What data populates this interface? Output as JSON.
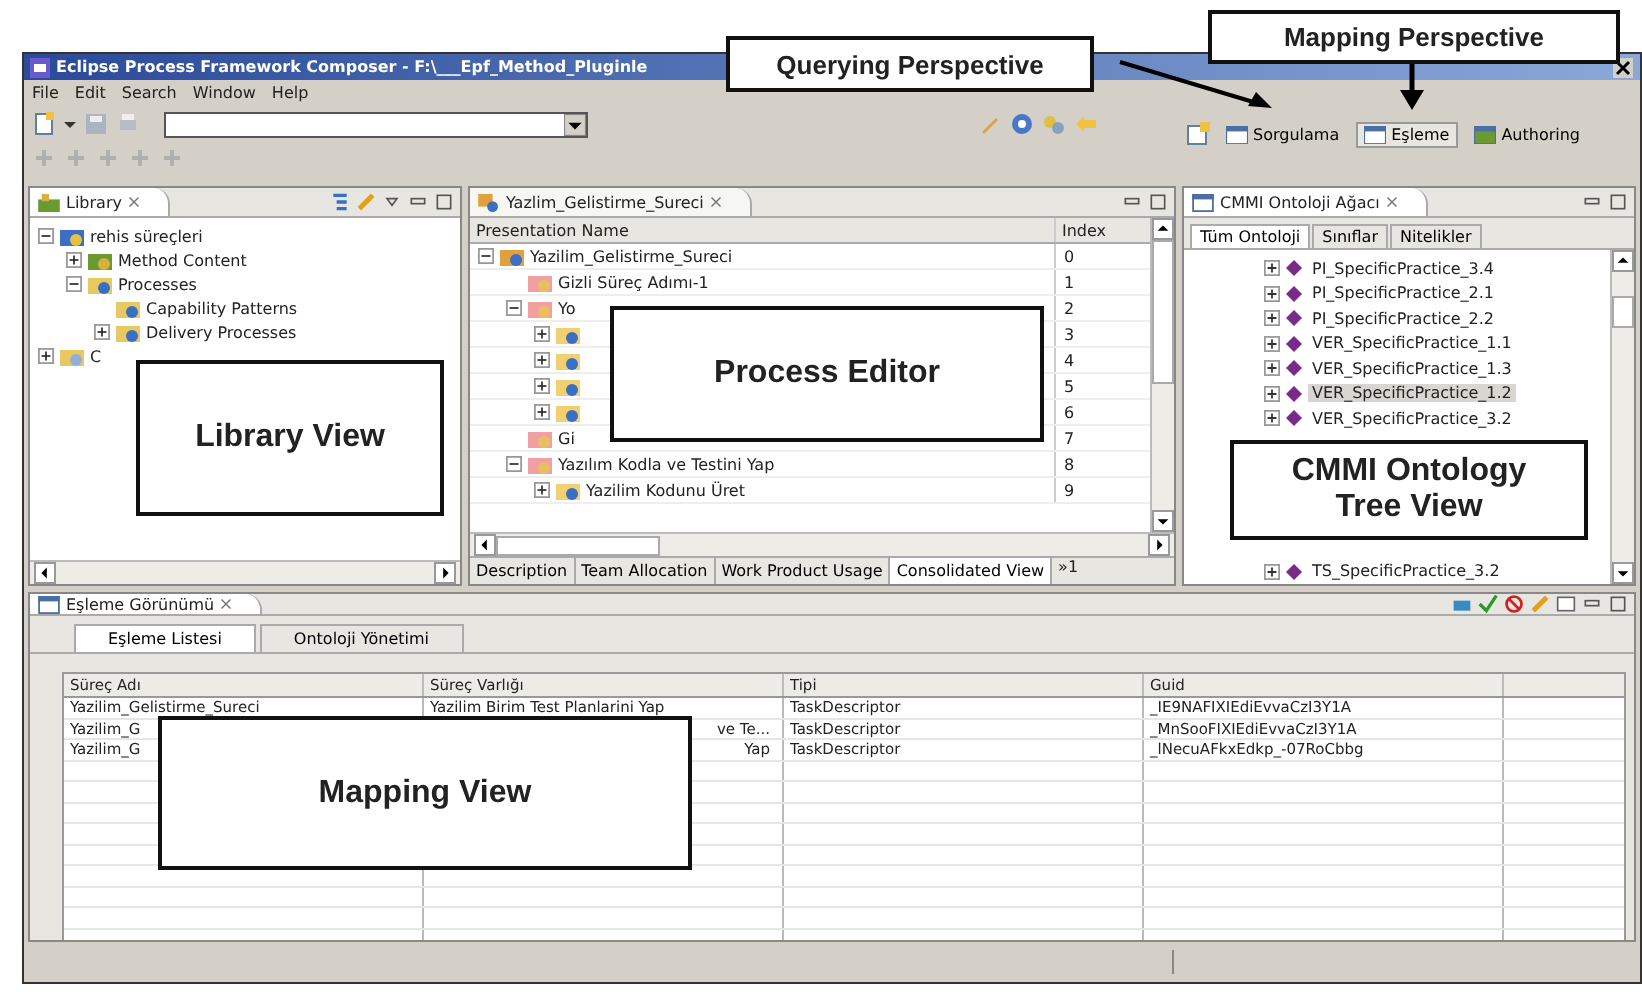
{
  "window": {
    "title": "Eclipse Process Framework Composer - F:\\___Epf_Method_Pluginle"
  },
  "menu": [
    "File",
    "Edit",
    "Search",
    "Window",
    "Help"
  ],
  "perspectives": [
    {
      "label": "Sorgulama",
      "selected": false
    },
    {
      "label": "Eşleme",
      "selected": true
    },
    {
      "label": "Authoring",
      "selected": false
    }
  ],
  "callouts": {
    "querying": "Querying Perspective",
    "mapping": "Mapping Perspective"
  },
  "library": {
    "title": "Library",
    "callout": "Library View",
    "tree": [
      {
        "label": "rehis süreçleri",
        "kind": "plugin",
        "expanded": true,
        "children": [
          {
            "label": "Method Content",
            "kind": "content",
            "expanded": false
          },
          {
            "label": "Processes",
            "kind": "processes",
            "expanded": true,
            "children": [
              {
                "label": "Capability Patterns",
                "kind": "pattern"
              },
              {
                "label": "Delivery Processes",
                "kind": "pattern",
                "expanded": false
              }
            ]
          }
        ]
      },
      {
        "label": "C",
        "kind": "folder",
        "expanded": false
      }
    ]
  },
  "editor": {
    "title": "Yazlim_Gelistirme_Sureci",
    "callout": "Process Editor",
    "columns": [
      "Presentation Name",
      "Index"
    ],
    "rows": [
      {
        "label": "Yazilim_Gelistirme_Sureci",
        "index": "0",
        "kind": "process",
        "expanded": true,
        "children": [
          {
            "label": "Gizli Süreç Adımı-1",
            "index": "1",
            "kind": "phase"
          },
          {
            "label": "Yo",
            "index": "2",
            "kind": "phase",
            "expanded": true,
            "children": [
              {
                "index": "3",
                "kind": "activity",
                "expanded": false
              },
              {
                "index": "4",
                "kind": "activity",
                "expanded": false
              },
              {
                "index": "5",
                "kind": "activity",
                "expanded": false
              },
              {
                "index": "6",
                "kind": "activity",
                "expanded": false
              }
            ]
          },
          {
            "label": "Gi",
            "index": "7",
            "kind": "phase"
          },
          {
            "label": "Yazılım Kodla ve Testini Yap",
            "index": "8",
            "kind": "phase",
            "expanded": true,
            "children": [
              {
                "label": "Yazilim Kodunu Üret",
                "index": "9",
                "kind": "activity",
                "expanded": false
              }
            ]
          }
        ]
      }
    ],
    "tabs": [
      {
        "label": "Description",
        "selected": false
      },
      {
        "label": "Team Allocation",
        "selected": false
      },
      {
        "label": "Work Product Usage",
        "selected": false
      },
      {
        "label": "Consolidated View",
        "selected": true
      }
    ],
    "overflow": "»1"
  },
  "ontology": {
    "title": "CMMI Ontoloji Ağacı",
    "callout": "CMMI Ontology\nTree View",
    "tabs": [
      {
        "label": "Tüm Ontoloji",
        "selected": true
      },
      {
        "label": "Sınıflar",
        "selected": false
      },
      {
        "label": "Nitelikler",
        "selected": false
      }
    ],
    "items": [
      {
        "label": "PI_SpecificPractice_3.4",
        "selected": false
      },
      {
        "label": "PI_SpecificPractice_2.1",
        "selected": false
      },
      {
        "label": "PI_SpecificPractice_2.2",
        "selected": false
      },
      {
        "label": "VER_SpecificPractice_1.1",
        "selected": false
      },
      {
        "label": "VER_SpecificPractice_1.3",
        "selected": false
      },
      {
        "label": "VER_SpecificPractice_1.2",
        "selected": true
      },
      {
        "label": "VER_SpecificPractice_3.2",
        "selected": false
      },
      {
        "label": "TS_SpecificPractice_3.2",
        "selected": false
      }
    ]
  },
  "mapping": {
    "title": "Eşleme Görünümü",
    "callout": "Mapping View",
    "tabs": [
      {
        "label": "Eşleme Listesi",
        "selected": true
      },
      {
        "label": "Ontoloji Yönetimi",
        "selected": false
      }
    ],
    "columns": [
      "Süreç Adı",
      "Süreç Varlığı",
      "Tipi",
      "Guid"
    ],
    "rows": [
      [
        "Yazilim_Gelistirme_Sureci",
        "Yazilim Birim Test Planlarini Yap",
        "TaskDescriptor",
        "_IE9NAFIXIEdiEvvaCzI3Y1A"
      ],
      [
        "Yazilim_G",
        "ve Te...",
        "TaskDescriptor",
        "_MnSooFIXIEdiEvvaCzI3Y1A"
      ],
      [
        "Yazilim_G",
        "Yap",
        "TaskDescriptor",
        "_lNecuAFkxEdkp_-07RoCbbg"
      ]
    ]
  }
}
